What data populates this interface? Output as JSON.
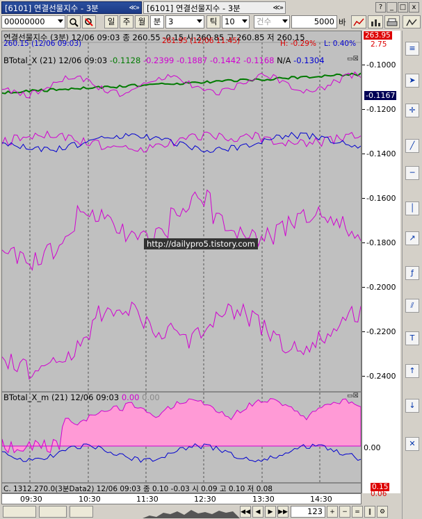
{
  "tabs": [
    {
      "code": "[6101]",
      "title": "연결선물지수",
      "period": "- 3분",
      "ctl": "≪»"
    },
    {
      "code": "[6101]",
      "title": "연결선물지수",
      "period": "- 3분",
      "ctl": "≪»"
    }
  ],
  "window_controls": [
    "?",
    "_",
    "□",
    "x"
  ],
  "toolbar": {
    "code_value": "00000000",
    "period_buttons": [
      "일",
      "주",
      "월",
      "분"
    ],
    "minute_value": "3",
    "tick_label": "틱",
    "tick_value": "10",
    "count_label": "건수",
    "count_value": "5000",
    "bar_label": "바"
  },
  "price_header": {
    "line1": "연결선물지수 (3분) 12/06 09:03   종 260.55 -0.15   시 260.85 고 260.85 저 260.15",
    "line2": "260.15 (12/06 09:03)",
    "line2b": "261.95 (12/06 11:45)",
    "high_pct": "H: -0.29%",
    "low_pct": "L: 0.40%",
    "price_tag": "263.95",
    "price_tag2": "2.75"
  },
  "panel1": {
    "title": "BTotal_X  (21) 12/06 09:03",
    "v1": "-0.1128",
    "v2": "-0.2399",
    "v3": "-0.1887",
    "v4": "-0.1442",
    "v5": "-0.1168",
    "v6": "N/A",
    "v7": "-0.1304",
    "current_tag": "-0.1167",
    "ticks": [
      "-0.1000",
      "-0.1200",
      "-0.1400",
      "-0.1600",
      "-0.1800",
      "-0.2000",
      "-0.2200",
      "-0.2400"
    ]
  },
  "panel2": {
    "title": "BTotal_X_m  (21) 12/06 09:03",
    "v1": "0.00",
    "v2": "0.00",
    "ticks": [
      "0.00"
    ]
  },
  "panel3": {
    "title": "C. 1312.270.0(3분Data2) 12/06 09:03   종 0.10 -0.03   시 0.09 고 0.10 저 0.08",
    "tag1": "0.15",
    "tag2": "0.06"
  },
  "xaxis_labels": [
    "09:30",
    "10:30",
    "11:30",
    "12:30",
    "13:30",
    "14:30"
  ],
  "watermark": "http://dailypro5.tistory.com",
  "statusbar": {
    "page_value": "123"
  },
  "colors": {
    "green": "#007a00",
    "magenta": "#d000d0",
    "blue": "#0000d0",
    "fill": "#ff9ad6",
    "bg": "#c0c0c0",
    "red": "#ff0000"
  },
  "rtool_icons": [
    "menu-icon",
    "cursor-icon",
    "cross-icon",
    "trend-icon",
    "hline-icon",
    "vline-icon",
    "arrow-icon",
    "fib-icon",
    "channel-icon",
    "text-icon",
    "up-icon",
    "down-icon",
    "x-icon"
  ]
}
